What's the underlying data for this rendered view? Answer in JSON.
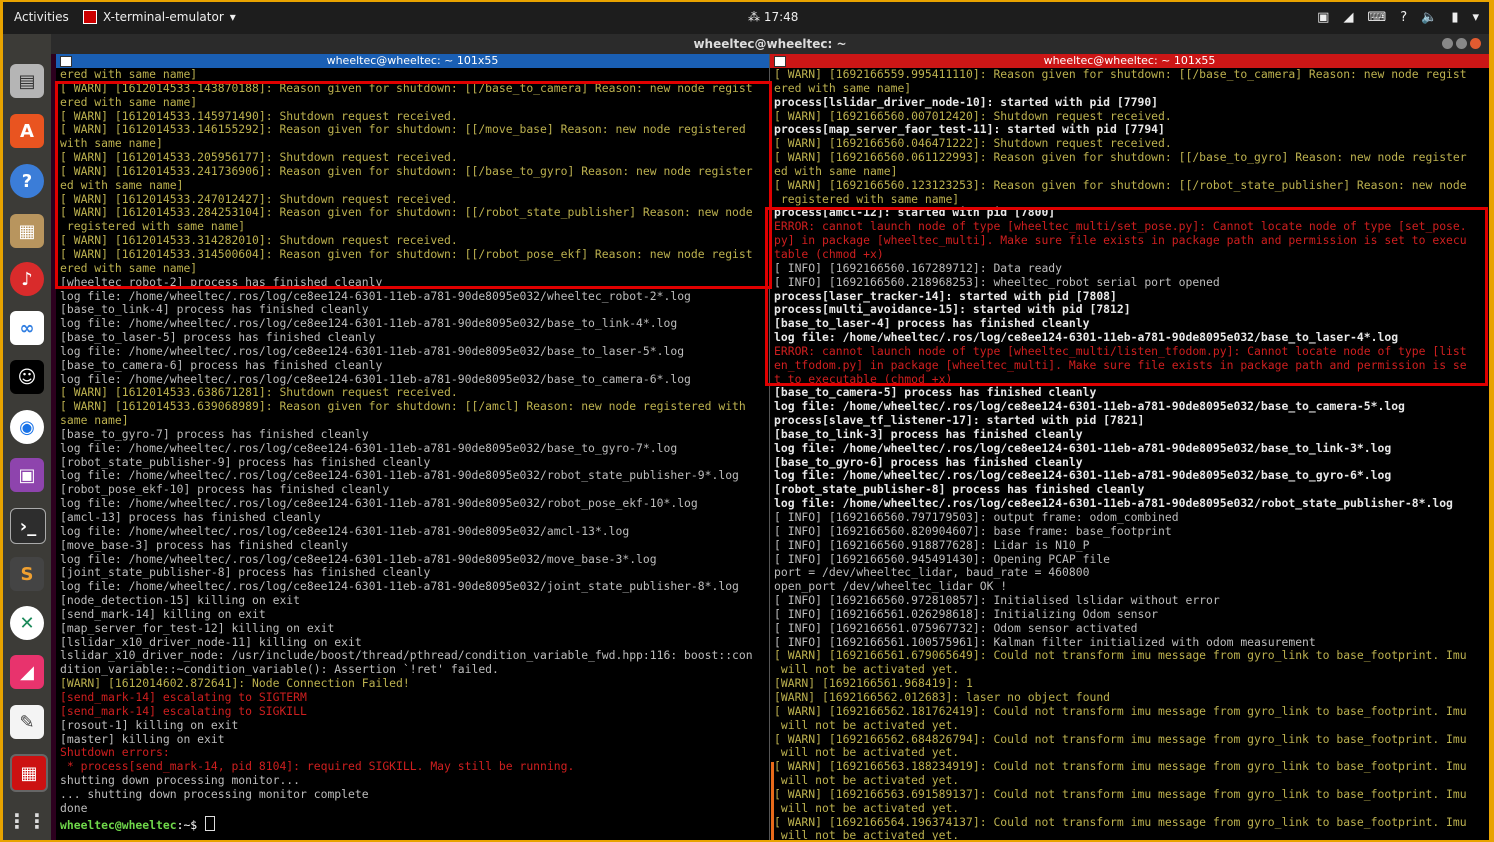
{
  "topbar": {
    "activities": "Activities",
    "app_name": "X-terminal-emulator",
    "clock": "17:48",
    "tray_question": "?"
  },
  "window": {
    "title": "wheeltec@wheeltec: ~"
  },
  "left_pane": {
    "title": "wheeltec@wheeltec: ~ 101x55",
    "lines": [
      {
        "t": "ered with same name]",
        "c": "w"
      },
      {
        "t": "[ WARN] [1612014533.143870188]: Reason given for shutdown: [[/base_to_camera] Reason: new node regist",
        "c": "w"
      },
      {
        "t": "ered with same name]",
        "c": "w"
      },
      {
        "t": "[ WARN] [1612014533.145971490]: Shutdown request received.",
        "c": "w"
      },
      {
        "t": "[ WARN] [1612014533.146155292]: Reason given for shutdown: [[/move_base] Reason: new node registered",
        "c": "w"
      },
      {
        "t": "with same name]",
        "c": "w"
      },
      {
        "t": "[ WARN] [1612014533.205956177]: Shutdown request received.",
        "c": "w"
      },
      {
        "t": "[ WARN] [1612014533.241736906]: Reason given for shutdown: [[/base_to_gyro] Reason: new node register",
        "c": "w"
      },
      {
        "t": "ed with same name]",
        "c": "w"
      },
      {
        "t": "[ WARN] [1612014533.247012427]: Shutdown request received.",
        "c": "w"
      },
      {
        "t": "[ WARN] [1612014533.284253104]: Reason given for shutdown: [[/robot_state_publisher] Reason: new node",
        "c": "w"
      },
      {
        "t": " registered with same name]",
        "c": "w"
      },
      {
        "t": "[ WARN] [1612014533.314282010]: Shutdown request received.",
        "c": "w"
      },
      {
        "t": "[ WARN] [1612014533.314500604]: Reason given for shutdown: [[/robot_pose_ekf] Reason: new node regist",
        "c": "w"
      },
      {
        "t": "ered with same name]",
        "c": "w"
      },
      {
        "t": "[wheeltec_robot-2] process has finished cleanly",
        "c": "n"
      },
      {
        "t": "log file: /home/wheeltec/.ros/log/ce8ee124-6301-11eb-a781-90de8095e032/wheeltec_robot-2*.log",
        "c": "n"
      },
      {
        "t": "[base_to_link-4] process has finished cleanly",
        "c": "n"
      },
      {
        "t": "log file: /home/wheeltec/.ros/log/ce8ee124-6301-11eb-a781-90de8095e032/base_to_link-4*.log",
        "c": "n"
      },
      {
        "t": "[base_to_laser-5] process has finished cleanly",
        "c": "n"
      },
      {
        "t": "log file: /home/wheeltec/.ros/log/ce8ee124-6301-11eb-a781-90de8095e032/base_to_laser-5*.log",
        "c": "n"
      },
      {
        "t": "[base_to_camera-6] process has finished cleanly",
        "c": "n"
      },
      {
        "t": "log file: /home/wheeltec/.ros/log/ce8ee124-6301-11eb-a781-90de8095e032/base_to_camera-6*.log",
        "c": "n"
      },
      {
        "t": "[ WARN] [1612014533.638671281]: Shutdown request received.",
        "c": "w"
      },
      {
        "t": "[ WARN] [1612014533.639068989]: Reason given for shutdown: [[/amcl] Reason: new node registered with",
        "c": "w"
      },
      {
        "t": "same name]",
        "c": "w"
      },
      {
        "t": "[base_to_gyro-7] process has finished cleanly",
        "c": "n"
      },
      {
        "t": "log file: /home/wheeltec/.ros/log/ce8ee124-6301-11eb-a781-90de8095e032/base_to_gyro-7*.log",
        "c": "n"
      },
      {
        "t": "[robot_state_publisher-9] process has finished cleanly",
        "c": "n"
      },
      {
        "t": "log file: /home/wheeltec/.ros/log/ce8ee124-6301-11eb-a781-90de8095e032/robot_state_publisher-9*.log",
        "c": "n"
      },
      {
        "t": "[robot_pose_ekf-10] process has finished cleanly",
        "c": "n"
      },
      {
        "t": "log file: /home/wheeltec/.ros/log/ce8ee124-6301-11eb-a781-90de8095e032/robot_pose_ekf-10*.log",
        "c": "n"
      },
      {
        "t": "[amcl-13] process has finished cleanly",
        "c": "n"
      },
      {
        "t": "log file: /home/wheeltec/.ros/log/ce8ee124-6301-11eb-a781-90de8095e032/amcl-13*.log",
        "c": "n"
      },
      {
        "t": "[move_base-3] process has finished cleanly",
        "c": "n"
      },
      {
        "t": "log file: /home/wheeltec/.ros/log/ce8ee124-6301-11eb-a781-90de8095e032/move_base-3*.log",
        "c": "n"
      },
      {
        "t": "[joint_state_publisher-8] process has finished cleanly",
        "c": "n"
      },
      {
        "t": "log file: /home/wheeltec/.ros/log/ce8ee124-6301-11eb-a781-90de8095e032/joint_state_publisher-8*.log",
        "c": "n"
      },
      {
        "t": "[node_detection-15] killing on exit",
        "c": "n"
      },
      {
        "t": "[send_mark-14] killing on exit",
        "c": "n"
      },
      {
        "t": "[map_server_for_test-12] killing on exit",
        "c": "n"
      },
      {
        "t": "[lslidar_x10_driver_node-11] killing on exit",
        "c": "n"
      },
      {
        "t": "lslidar_x10_driver_node: /usr/include/boost/thread/pthread/condition_variable_fwd.hpp:116: boost::con",
        "c": "n"
      },
      {
        "t": "dition_variable::~condition_variable(): Assertion `!ret' failed.",
        "c": "n"
      },
      {
        "t": "[WARN] [1612014602.872641]: Node Connection Failed!",
        "c": "w"
      },
      {
        "t": "[send_mark-14] escalating to SIGTERM",
        "c": "e"
      },
      {
        "t": "[send_mark-14] escalating to SIGKILL",
        "c": "e"
      },
      {
        "t": "[rosout-1] killing on exit",
        "c": "n"
      },
      {
        "t": "[master] killing on exit",
        "c": "n"
      },
      {
        "t": "Shutdown errors:",
        "c": "e"
      },
      {
        "t": " * process[send_mark-14, pid 8104]: required SIGKILL. May still be running.",
        "c": "e"
      },
      {
        "t": "shutting down processing monitor...",
        "c": "n"
      },
      {
        "t": "... shutting down processing monitor complete",
        "c": "n"
      },
      {
        "t": "done",
        "c": "n"
      }
    ],
    "prompt": "wheeltec@wheeltec",
    "prompt_suffix": ":~$ "
  },
  "right_pane": {
    "title": "wheeltec@wheeltec: ~ 101x55",
    "lines": [
      {
        "t": "[ WARN] [1692166559.995411110]: Reason given for shutdown: [[/base_to_camera] Reason: new node regist",
        "c": "w"
      },
      {
        "t": "ered with same name]",
        "c": "w"
      },
      {
        "t": "process[lslidar_driver_node-10]: started with pid [7790]",
        "c": "b"
      },
      {
        "t": "[ WARN] [1692166560.007012420]: Shutdown request received.",
        "c": "w"
      },
      {
        "t": "process[map_server_faor_test-11]: started with pid [7794]",
        "c": "b"
      },
      {
        "t": "[ WARN] [1692166560.046471222]: Shutdown request received.",
        "c": "w"
      },
      {
        "t": "[ WARN] [1692166560.061122993]: Reason given for shutdown: [[/base_to_gyro] Reason: new node register",
        "c": "w"
      },
      {
        "t": "ed with same name]",
        "c": "w"
      },
      {
        "t": "[ WARN] [1692166560.123123253]: Reason given for shutdown: [[/robot_state_publisher] Reason: new node",
        "c": "w"
      },
      {
        "t": " registered with same name]",
        "c": "w"
      },
      {
        "t": "process[amcl-12]: started with pid [7800]",
        "c": "b"
      },
      {
        "t": "ERROR: cannot launch node of type [wheeltec_multi/set_pose.py]: Cannot locate node of type [set_pose.",
        "c": "e"
      },
      {
        "t": "py] in package [wheeltec_multi]. Make sure file exists in package path and permission is set to execu",
        "c": "e"
      },
      {
        "t": "table (chmod +x)",
        "c": "e"
      },
      {
        "t": "[ INFO] [1692166560.167289712]: Data ready",
        "c": "n"
      },
      {
        "t": "[ INFO] [1692166560.218968253]: wheeltec_robot serial port opened",
        "c": "n"
      },
      {
        "t": "process[laser_tracker-14]: started with pid [7808]",
        "c": "b"
      },
      {
        "t": "process[multi_avoidance-15]: started with pid [7812]",
        "c": "b"
      },
      {
        "t": "[base_to_laser-4] process has finished cleanly",
        "c": "b"
      },
      {
        "t": "log file: /home/wheeltec/.ros/log/ce8ee124-6301-11eb-a781-90de8095e032/base_to_laser-4*.log",
        "c": "b"
      },
      {
        "t": "ERROR: cannot launch node of type [wheeltec_multi/listen_tfodom.py]: Cannot locate node of type [list",
        "c": "e"
      },
      {
        "t": "en_tfodom.py] in package [wheeltec_multi]. Make sure file exists in package path and permission is se",
        "c": "e"
      },
      {
        "t": "t to executable (chmod +x)",
        "c": "e"
      },
      {
        "t": "[base_to_camera-5] process has finished cleanly",
        "c": "b"
      },
      {
        "t": "log file: /home/wheeltec/.ros/log/ce8ee124-6301-11eb-a781-90de8095e032/base_to_camera-5*.log",
        "c": "b"
      },
      {
        "t": "process[slave_tf_listener-17]: started with pid [7821]",
        "c": "b"
      },
      {
        "t": "[base_to_link-3] process has finished cleanly",
        "c": "b"
      },
      {
        "t": "log file: /home/wheeltec/.ros/log/ce8ee124-6301-11eb-a781-90de8095e032/base_to_link-3*.log",
        "c": "b"
      },
      {
        "t": "[base_to_gyro-6] process has finished cleanly",
        "c": "b"
      },
      {
        "t": "log file: /home/wheeltec/.ros/log/ce8ee124-6301-11eb-a781-90de8095e032/base_to_gyro-6*.log",
        "c": "b"
      },
      {
        "t": "[robot_state_publisher-8] process has finished cleanly",
        "c": "b"
      },
      {
        "t": "log file: /home/wheeltec/.ros/log/ce8ee124-6301-11eb-a781-90de8095e032/robot_state_publisher-8*.log",
        "c": "b"
      },
      {
        "t": "[ INFO] [1692166560.797179503]: output frame: odom_combined",
        "c": "n"
      },
      {
        "t": "[ INFO] [1692166560.820904607]: base frame: base_footprint",
        "c": "n"
      },
      {
        "t": "[ INFO] [1692166560.918877628]: Lidar is N10_P",
        "c": "n"
      },
      {
        "t": "[ INFO] [1692166560.945491430]: Opening PCAP file",
        "c": "n"
      },
      {
        "t": "port = /dev/wheeltec_lidar, baud_rate = 460800",
        "c": "n"
      },
      {
        "t": "open_port /dev/wheeltec_lidar OK !",
        "c": "n"
      },
      {
        "t": "[ INFO] [1692166560.972810857]: Initialised lslidar without error",
        "c": "n"
      },
      {
        "t": "[ INFO] [1692166561.026298618]: Initializing Odom sensor",
        "c": "n"
      },
      {
        "t": "[ INFO] [1692166561.075967732]: Odom sensor activated",
        "c": "n"
      },
      {
        "t": "[ INFO] [1692166561.100575961]: Kalman filter initialized with odom measurement",
        "c": "n"
      },
      {
        "t": "[ WARN] [1692166561.679065649]: Could not transform imu message from gyro_link to base_footprint. Imu",
        "c": "w"
      },
      {
        "t": " will not be activated yet.",
        "c": "w"
      },
      {
        "t": "[WARN] [1692166561.968419]: 1",
        "c": "w"
      },
      {
        "t": "[WARN] [1692166562.012683]: laser no object found",
        "c": "w"
      },
      {
        "t": "[ WARN] [1692166562.181762419]: Could not transform imu message from gyro_link to base_footprint. Imu",
        "c": "w"
      },
      {
        "t": " will not be activated yet.",
        "c": "w"
      },
      {
        "t": "[ WARN] [1692166562.684826794]: Could not transform imu message from gyro_link to base_footprint. Imu",
        "c": "w"
      },
      {
        "t": " will not be activated yet.",
        "c": "w"
      },
      {
        "t": "[ WARN] [1692166563.188234919]: Could not transform imu message from gyro_link to base_footprint. Imu",
        "c": "w"
      },
      {
        "t": " will not be activated yet.",
        "c": "w"
      },
      {
        "t": "[ WARN] [1692166563.691589137]: Could not transform imu message from gyro_link to base_footprint. Imu",
        "c": "w"
      },
      {
        "t": " will not be activated yet.",
        "c": "w"
      },
      {
        "t": "[ WARN] [1692166564.196374137]: Could not transform imu message from gyro_link to base_footprint. Imu",
        "c": "w"
      },
      {
        "t": " will not be activated yet.",
        "c": "w"
      }
    ]
  },
  "colors": {
    "warn": "#bcb14f",
    "error": "#cf1f1f",
    "prompt": "#6fd84a",
    "highlight": "#e00000",
    "left_title": "#1a5fb4",
    "right_title": "#cc1616"
  },
  "dock": [
    {
      "name": "files-icon"
    },
    {
      "name": "software-center-icon"
    },
    {
      "name": "help-icon"
    },
    {
      "name": "archive-manager-icon"
    },
    {
      "name": "netease-music-icon"
    },
    {
      "name": "baidu-netdisk-icon"
    },
    {
      "name": "qq-icon"
    },
    {
      "name": "chrome-icon"
    },
    {
      "name": "screen-recorder-icon"
    },
    {
      "name": "terminal-icon"
    },
    {
      "name": "sublime-text-icon"
    },
    {
      "name": "xmind-icon"
    },
    {
      "name": "feishu-icon"
    },
    {
      "name": "text-editor-icon"
    },
    {
      "name": "terminator-icon"
    },
    {
      "name": "show-applications-icon"
    }
  ]
}
